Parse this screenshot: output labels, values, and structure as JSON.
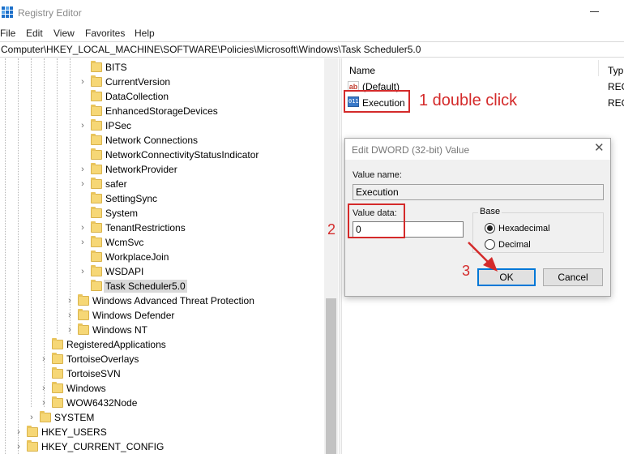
{
  "window": {
    "title": "Registry Editor"
  },
  "menu": [
    "File",
    "Edit",
    "View",
    "Favorites",
    "Help"
  ],
  "address": "Computer\\HKEY_LOCAL_MACHINE\\SOFTWARE\\Policies\\Microsoft\\Windows\\Task Scheduler5.0",
  "tree": [
    {
      "label": "BITS",
      "level": 3,
      "expandable": false,
      "selected": false
    },
    {
      "label": "CurrentVersion",
      "level": 3,
      "expandable": true,
      "selected": false
    },
    {
      "label": "DataCollection",
      "level": 3,
      "expandable": false,
      "selected": false
    },
    {
      "label": "EnhancedStorageDevices",
      "level": 3,
      "expandable": false,
      "selected": false
    },
    {
      "label": "IPSec",
      "level": 3,
      "expandable": true,
      "selected": false
    },
    {
      "label": "Network Connections",
      "level": 3,
      "expandable": false,
      "selected": false
    },
    {
      "label": "NetworkConnectivityStatusIndicator",
      "level": 3,
      "expandable": false,
      "selected": false
    },
    {
      "label": "NetworkProvider",
      "level": 3,
      "expandable": true,
      "selected": false
    },
    {
      "label": "safer",
      "level": 3,
      "expandable": true,
      "selected": false
    },
    {
      "label": "SettingSync",
      "level": 3,
      "expandable": false,
      "selected": false
    },
    {
      "label": "System",
      "level": 3,
      "expandable": false,
      "selected": false
    },
    {
      "label": "TenantRestrictions",
      "level": 3,
      "expandable": true,
      "selected": false
    },
    {
      "label": "WcmSvc",
      "level": 3,
      "expandable": true,
      "selected": false
    },
    {
      "label": "WorkplaceJoin",
      "level": 3,
      "expandable": false,
      "selected": false
    },
    {
      "label": "WSDAPI",
      "level": 3,
      "expandable": true,
      "selected": false
    },
    {
      "label": "Task Scheduler5.0",
      "level": 3,
      "expandable": false,
      "selected": true
    },
    {
      "label": "Windows Advanced Threat Protection",
      "level": 2,
      "expandable": true,
      "selected": false
    },
    {
      "label": "Windows Defender",
      "level": 2,
      "expandable": true,
      "selected": false
    },
    {
      "label": "Windows NT",
      "level": 2,
      "expandable": true,
      "selected": false
    },
    {
      "label": "RegisteredApplications",
      "level": 1,
      "expandable": false,
      "selected": false
    },
    {
      "label": "TortoiseOverlays",
      "level": 1,
      "expandable": true,
      "selected": false
    },
    {
      "label": "TortoiseSVN",
      "level": 1,
      "expandable": false,
      "selected": false
    },
    {
      "label": "Windows",
      "level": 1,
      "expandable": true,
      "selected": false
    },
    {
      "label": "WOW6432Node",
      "level": 1,
      "expandable": true,
      "selected": false
    },
    {
      "label": "SYSTEM",
      "level": 0,
      "expandable": true,
      "selected": false
    },
    {
      "label": "HKEY_USERS",
      "level": -1,
      "expandable": true,
      "selected": false
    },
    {
      "label": "HKEY_CURRENT_CONFIG",
      "level": -1,
      "expandable": true,
      "selected": false
    }
  ],
  "values_list": {
    "col_name": "Name",
    "col_type": "Typ",
    "rows": [
      {
        "name": "(Default)",
        "type": "REG",
        "icon": "string-value-icon"
      },
      {
        "name": "Execution",
        "type": "REG",
        "icon": "dword-value-icon"
      }
    ]
  },
  "annotations": {
    "step1": "1 double click",
    "step2": "2",
    "step3": "3",
    "color": "#d42a2a"
  },
  "dialog": {
    "title": "Edit DWORD (32-bit) Value",
    "close_glyph": "✕",
    "value_name_label": "Value name:",
    "value_name": "Execution",
    "value_data_label": "Value data:",
    "value_data": "0",
    "base_label": "Base",
    "base_options": [
      "Hexadecimal",
      "Decimal"
    ],
    "base_selected": "Hexadecimal",
    "ok_label": "OK",
    "cancel_label": "Cancel"
  }
}
